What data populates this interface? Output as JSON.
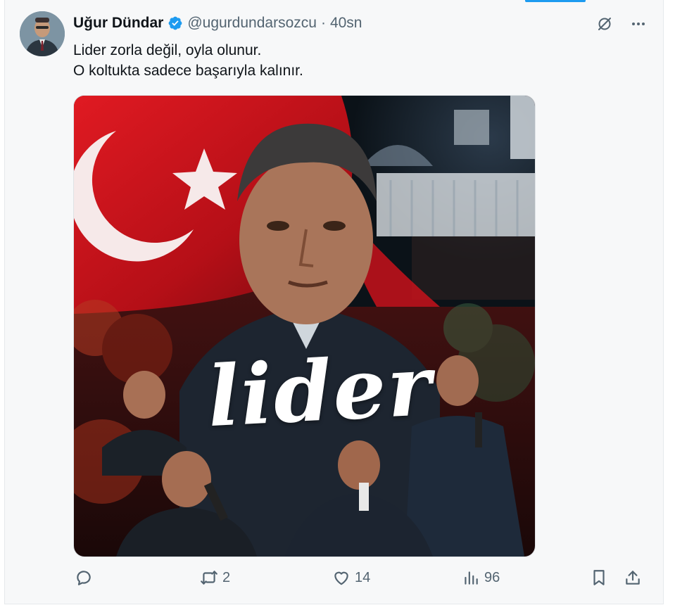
{
  "tweet": {
    "author_name": "Uğur Dündar",
    "handle": "@ugurdundarsozcu",
    "separator": "·",
    "time": "40sn",
    "text_lines": [
      "Lider zorla değil, oyla olunur.",
      "O koltukta sadece başarıyla kalınır."
    ],
    "media_text": "lider"
  },
  "actions": {
    "reply_count": "",
    "retweet_count": "2",
    "like_count": "14",
    "views_count": "96"
  },
  "colors": {
    "accent": "#1d9bf0",
    "text_primary": "#0f1419",
    "text_secondary": "#536471",
    "flag_red": "#d4141d"
  },
  "icons": [
    "grok-icon",
    "more-icon",
    "verified-badge-icon",
    "reply-icon",
    "retweet-icon",
    "like-icon",
    "views-icon",
    "bookmark-icon",
    "share-icon"
  ]
}
